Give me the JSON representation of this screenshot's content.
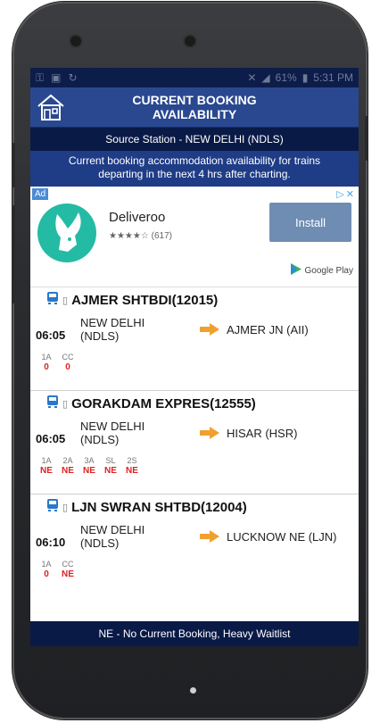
{
  "status_bar": {
    "battery": "61%",
    "time": "5:31 PM"
  },
  "header": {
    "title_line1": "CURRENT BOOKING",
    "title_line2": "AVAILABILITY",
    "source": "Source Station - NEW DELHI (NDLS)",
    "info_line1": "Current booking accommodation availability for trains",
    "info_line2": "departing in the next 4 hrs after charting."
  },
  "ad": {
    "badge": "Ad",
    "app_name": "Deliveroo",
    "stars": "★★★★☆",
    "rating_count": "(617)",
    "install_label": "Install",
    "store_label": "Google Play"
  },
  "trains": [
    {
      "name": "AJMER SHTBDI(12015)",
      "time": "06:05",
      "from_line1": "NEW DELHI",
      "from_line2": "(NDLS)",
      "dest": "AJMER JN (AII)",
      "classes": [
        {
          "c": "1A",
          "v": "0"
        },
        {
          "c": "CC",
          "v": "0"
        }
      ]
    },
    {
      "name": "GORAKDAM EXPRES(12555)",
      "time": "06:05",
      "from_line1": "NEW DELHI",
      "from_line2": "(NDLS)",
      "dest": "HISAR (HSR)",
      "classes": [
        {
          "c": "1A",
          "v": "NE"
        },
        {
          "c": "2A",
          "v": "NE"
        },
        {
          "c": "3A",
          "v": "NE"
        },
        {
          "c": "SL",
          "v": "NE"
        },
        {
          "c": "2S",
          "v": "NE"
        }
      ]
    },
    {
      "name": "LJN SWRAN SHTBD(12004)",
      "time": "06:10",
      "from_line1": "NEW DELHI",
      "from_line2": "(NDLS)",
      "dest": "LUCKNOW NE (LJN)",
      "classes": [
        {
          "c": "1A",
          "v": "0"
        },
        {
          "c": "CC",
          "v": "NE"
        }
      ]
    }
  ],
  "footer": "NE - No Current Booking, Heavy Waitlist",
  "colors": {
    "header_blue": "#2a4890",
    "dark_navy": "#0a1a47",
    "value_red": "#e02020",
    "arrow_orange": "#f0a030"
  }
}
